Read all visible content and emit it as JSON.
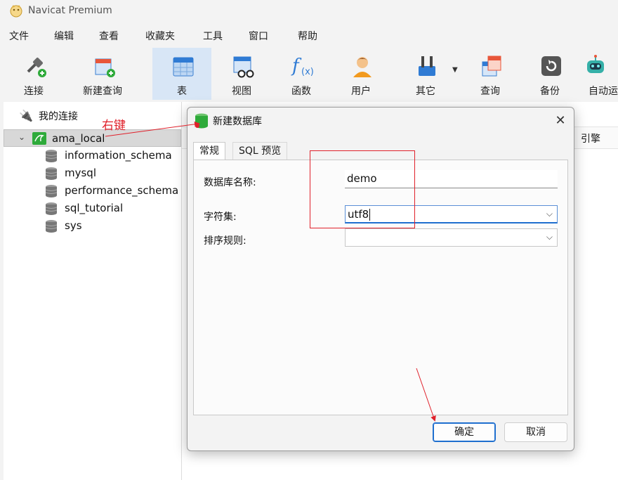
{
  "app": {
    "title": "Navicat Premium"
  },
  "menu": [
    "文件",
    "编辑",
    "查看",
    "收藏夹",
    "工具",
    "窗口",
    "帮助"
  ],
  "toolbar": [
    {
      "label": "连接",
      "icon": "plug-connect-icon"
    },
    {
      "label": "新建查询",
      "icon": "new-query-icon"
    },
    {
      "label": "表",
      "icon": "table-icon",
      "active": true
    },
    {
      "label": "视图",
      "icon": "view-icon"
    },
    {
      "label": "函数",
      "icon": "function-icon"
    },
    {
      "label": "用户",
      "icon": "user-icon"
    },
    {
      "label": "其它",
      "icon": "other-tools-icon"
    },
    {
      "label": "查询",
      "icon": "query-icon"
    },
    {
      "label": "备份",
      "icon": "backup-icon"
    },
    {
      "label": "自动运",
      "icon": "robot-icon"
    }
  ],
  "tree": {
    "root": "我的连接",
    "connection": "ama_local",
    "databases": [
      "information_schema",
      "mysql",
      "performance_schema",
      "sql_tutorial",
      "sys"
    ]
  },
  "annotation": {
    "right_click": "右键"
  },
  "right_pane": {
    "column_engine": "引擎"
  },
  "dialog": {
    "title": "新建数据库",
    "tabs": [
      "常规",
      "SQL 预览"
    ],
    "fields": {
      "name_label": "数据库名称:",
      "name_value": "demo",
      "charset_label": "字符集:",
      "charset_value": "utf8",
      "collation_label": "排序规则:",
      "collation_value": ""
    },
    "ok": "确定",
    "cancel": "取消"
  },
  "colors": {
    "accent": "#1f6fcf",
    "annotation": "#e0202a",
    "active_tab": "#d8e6f6"
  }
}
